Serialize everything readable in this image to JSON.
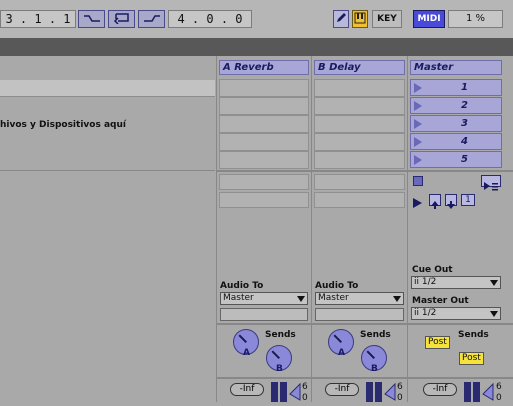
{
  "transport": {
    "position": "3 . 1 . 1",
    "loop_length": "4 . 0 . 0",
    "key_label": "KEY",
    "midi_label": "MIDI",
    "cpu_label": "1 %"
  },
  "icons": {
    "draw": "pencil-icon",
    "piano": "piano-keys-icon",
    "loop": "loop-icon",
    "punch_in": "punch-in-icon",
    "punch_out": "punch-out-icon"
  },
  "session": {
    "drop_hint": "hivos y Dispositivos aquí"
  },
  "tracks": [
    {
      "name": "A Reverb",
      "audio_to_label": "Audio To",
      "audio_to_value": "Master",
      "sends_label": "Sends",
      "knob_a": "A",
      "knob_b": "B",
      "volume": "-Inf",
      "meter_top": "6",
      "meter_bottom": "0"
    },
    {
      "name": "B Delay",
      "audio_to_label": "Audio To",
      "audio_to_value": "Master",
      "sends_label": "Sends",
      "knob_a": "A",
      "knob_b": "B",
      "volume": "-Inf",
      "meter_top": "6",
      "meter_bottom": "0"
    }
  ],
  "master": {
    "name": "Master",
    "scenes": [
      "1",
      "2",
      "3",
      "4",
      "5"
    ],
    "scene_count": "1",
    "cue_out_label": "Cue Out",
    "cue_out_value": "ii 1/2",
    "master_out_label": "Master Out",
    "master_out_value": "ii 1/2",
    "sends_label": "Sends",
    "post_1": "Post",
    "post_2": "Post",
    "volume": "-Inf",
    "meter_top": "6",
    "meter_bottom": "0"
  },
  "colors": {
    "accent": "#a7a6d6",
    "midi_active": "#4a4ad8",
    "post_yellow": "#f5e23a"
  }
}
